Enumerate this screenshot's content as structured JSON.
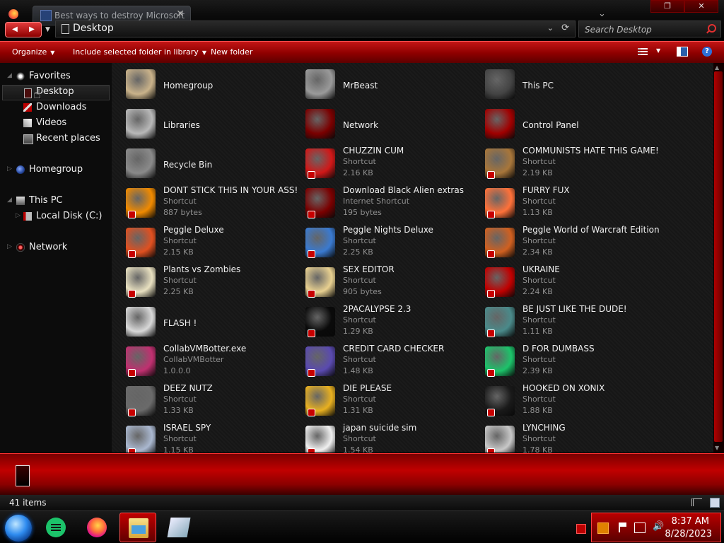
{
  "browser_tab": {
    "title": "Best ways to destroy Microsoft",
    "close": "✕"
  },
  "address": {
    "path": "Desktop",
    "chevron": "⌄",
    "refresh": "⟳"
  },
  "search": {
    "placeholder": "Search Desktop"
  },
  "nav_buttons": {
    "back": "◀",
    "forward": "▶"
  },
  "command_bar": {
    "organize": "Organize",
    "include": "Include selected folder in library",
    "new_folder": "New folder",
    "help": "?"
  },
  "nav_pane": {
    "favorites": "Favorites",
    "desktop": "Desktop",
    "downloads": "Downloads",
    "videos": "Videos",
    "recent": "Recent places",
    "homegroup": "Homegroup",
    "this_pc": "This PC",
    "local_disk": "Local Disk (C:)",
    "network": "Network"
  },
  "items": [
    {
      "name": "Homegroup",
      "type": "",
      "size": "",
      "icon": "homegroup-icon",
      "color": "#c9b28a"
    },
    {
      "name": "MrBeast",
      "type": "",
      "size": "",
      "icon": "library-icon",
      "color": "#9a9a9a"
    },
    {
      "name": "This PC",
      "type": "",
      "size": "",
      "icon": "computer-icon",
      "color": "#444444"
    },
    {
      "name": "Libraries",
      "type": "",
      "size": "",
      "icon": "library-icon",
      "color": "#b8b8b8"
    },
    {
      "name": "Network",
      "type": "",
      "size": "",
      "icon": "network-icon",
      "color": "#7a0000"
    },
    {
      "name": "Control Panel",
      "type": "",
      "size": "",
      "icon": "control-panel-icon",
      "color": "#a00000"
    },
    {
      "name": "Recycle Bin",
      "type": "",
      "size": "",
      "icon": "recycle-bin-icon",
      "color": "#8a8a8a"
    },
    {
      "name": "CHUZZIN CUM",
      "type": "Shortcut",
      "size": "2.16 KB",
      "icon": "chuzzle-icon",
      "color": "#d01818"
    },
    {
      "name": "COMMUNISTS HATE THIS GAME!",
      "type": "Shortcut",
      "size": "2.19 KB",
      "icon": "money-bag-icon",
      "color": "#a8763a"
    },
    {
      "name": "DONT STICK THIS IN YOUR ASS!",
      "type": "Shortcut",
      "size": "887 bytes",
      "icon": "vlc-cone-icon",
      "color": "#f08a00"
    },
    {
      "name": "Download Black Alien extras",
      "type": "Internet Shortcut",
      "size": "195 bytes",
      "icon": "network-icon",
      "color": "#7a0000"
    },
    {
      "name": "FURRY FUX",
      "type": "Shortcut",
      "size": "1.13 KB",
      "icon": "firefox-icon",
      "color": "#ff7139"
    },
    {
      "name": "Peggle Deluxe",
      "type": "Shortcut",
      "size": "2.15 KB",
      "icon": "peggle-icon",
      "color": "#e05020"
    },
    {
      "name": "Peggle Nights Deluxe",
      "type": "Shortcut",
      "size": "2.25 KB",
      "icon": "peggle-icon",
      "color": "#3a7ad0"
    },
    {
      "name": "Peggle World of Warcraft Edition",
      "type": "Shortcut",
      "size": "2.34 KB",
      "icon": "peggle-icon",
      "color": "#d06020"
    },
    {
      "name": "Plants vs Zombies",
      "type": "Shortcut",
      "size": "2.25 KB",
      "icon": "flower-icon",
      "color": "#e8e0c0"
    },
    {
      "name": "SEX EDITOR",
      "type": "Shortcut",
      "size": "905 bytes",
      "icon": "hex-editor-icon",
      "color": "#e8d090"
    },
    {
      "name": "UKRAINE",
      "type": "Shortcut",
      "size": "2.24 KB",
      "icon": "radiation-icon",
      "color": "#c00000"
    },
    {
      "name": "FLASH !",
      "type": "",
      "size": "",
      "icon": "flash-icon",
      "color": "#d8d8d8"
    },
    {
      "name": "2PACALYPSE 2.3",
      "type": "Shortcut",
      "size": "1.29 KB",
      "icon": "terminal-icon",
      "color": "#0a0a0a"
    },
    {
      "name": "BE JUST LIKE THE DUDE!",
      "type": "Shortcut",
      "size": "1.11 KB",
      "icon": "dude-icon",
      "color": "#4a8a8a"
    },
    {
      "name": "CollabVMBotter.exe",
      "type": "CollabVMBotter",
      "size": "1.0.0.0",
      "icon": "app-icon",
      "color": "#c03070"
    },
    {
      "name": "CREDIT CARD CHECKER",
      "type": "Shortcut",
      "size": "1.48 KB",
      "icon": "credit-card-icon",
      "color": "#5a4ab0"
    },
    {
      "name": "D FOR DUMBASS",
      "type": "Shortcut",
      "size": "2.39 KB",
      "icon": "chat-icon",
      "color": "#1cc36a"
    },
    {
      "name": "DEEZ NUTZ",
      "type": "Shortcut",
      "size": "1.33 KB",
      "icon": "windows-stack-icon",
      "color": "#6a6a6a"
    },
    {
      "name": "DIE PLEASE",
      "type": "Shortcut",
      "size": "1.31 KB",
      "icon": "die-icon",
      "color": "#e8b020"
    },
    {
      "name": "HOOKED ON XONIX",
      "type": "Shortcut",
      "size": "1.88 KB",
      "icon": "xonix-icon",
      "color": "#1a1a1a"
    },
    {
      "name": "ISRAEL SPY",
      "type": "Shortcut",
      "size": "1.15 KB",
      "icon": "camera-icon",
      "color": "#aab8d0"
    },
    {
      "name": "japan suicide sim",
      "type": "Shortcut",
      "size": "1.54 KB",
      "icon": "game-icon",
      "color": "#f0f0f0"
    },
    {
      "name": "LYNCHING",
      "type": "Shortcut",
      "size": "1.78 KB",
      "icon": "rope-icon",
      "color": "#c8c8c8"
    }
  ],
  "status": {
    "count": "41 items"
  },
  "tray": {
    "time": "8:37 AM",
    "date": "8/28/2023",
    "volume": "🔊"
  }
}
